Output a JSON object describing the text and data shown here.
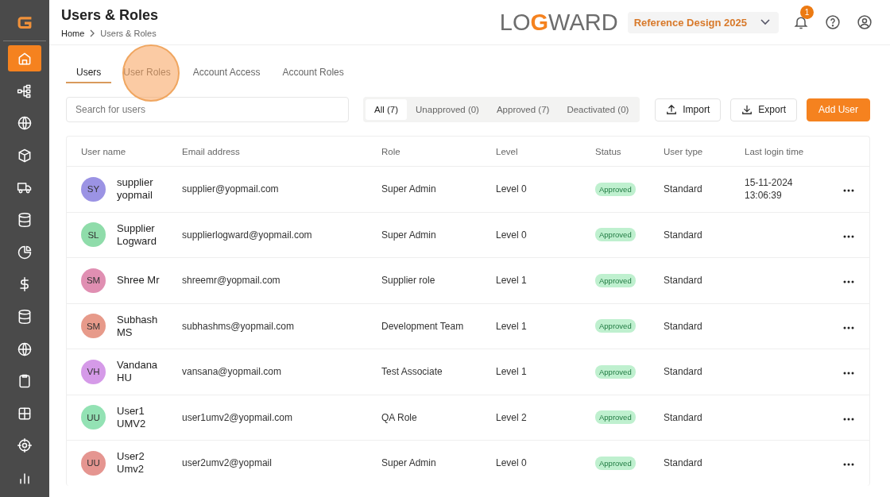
{
  "sidebar": {
    "items": [
      {
        "selected": true
      },
      {
        "selected": false
      },
      {
        "selected": false
      },
      {
        "selected": false
      },
      {
        "selected": false
      },
      {
        "selected": false
      },
      {
        "selected": false
      },
      {
        "selected": false
      },
      {
        "selected": false
      },
      {
        "selected": false
      },
      {
        "selected": false
      },
      {
        "selected": false
      },
      {
        "selected": false
      },
      {
        "selected": false
      }
    ]
  },
  "header": {
    "title": "Users & Roles",
    "breadcrumb": [
      "Home",
      "Users & Roles"
    ],
    "logo": {
      "before": "LO",
      "mark": "G",
      "after": "WARD"
    },
    "workspace": "Reference Design 2025",
    "notifications": "1"
  },
  "tabs": [
    {
      "label": "Users",
      "selected": true,
      "tapped": false
    },
    {
      "label": "User Roles",
      "selected": false,
      "tapped": true
    },
    {
      "label": "Account Access",
      "selected": false,
      "tapped": false
    },
    {
      "label": "Account Roles",
      "selected": false,
      "tapped": false
    }
  ],
  "search": {
    "placeholder": "Search for users"
  },
  "filters": [
    {
      "label": "All (7)",
      "selected": true
    },
    {
      "label": "Unapproved (0)",
      "selected": false
    },
    {
      "label": "Approved (7)",
      "selected": false
    },
    {
      "label": "Deactivated (0)",
      "selected": false
    }
  ],
  "buttons": [
    {
      "label": "Import",
      "kind": "import"
    },
    {
      "label": "Export",
      "kind": "export"
    },
    {
      "label": "Add User",
      "kind": "primary"
    }
  ],
  "table": {
    "columns": [
      "User name",
      "Email address",
      "Role",
      "Level",
      "Status",
      "User type",
      "Last login time"
    ],
    "rows": [
      {
        "initials": "SY",
        "color": "#9b93e4",
        "name": "supplier yopmail",
        "email": "supplier@yopmail.com",
        "role": "Super Admin",
        "level": "Level 0",
        "status": "Approved",
        "user_type": "Standard",
        "last_login": "15-11-2024 13:06:39"
      },
      {
        "initials": "SL",
        "color": "#8fdcaa",
        "name": "Supplier Logward",
        "email": "supplierlogward@yopmail.com",
        "role": "Super Admin",
        "level": "Level 0",
        "status": "Approved",
        "user_type": "Standard"
      },
      {
        "initials": "SM",
        "color": "#e08fb2",
        "name": "Shree Mr",
        "email": "shreemr@yopmail.com",
        "role": "Supplier role",
        "level": "Level 1",
        "status": "Approved",
        "user_type": "Standard"
      },
      {
        "initials": "SM",
        "color": "#e79a8a",
        "name": "Subhash MS",
        "email": "subhashms@yopmail.com",
        "role": "Development Team",
        "level": "Level 1",
        "status": "Approved",
        "user_type": "Standard"
      },
      {
        "initials": "VH",
        "color": "#d59ae8",
        "name": "Vandana HU",
        "email": "vansana@yopmail.com",
        "role": "Test Associate",
        "level": "Level 1",
        "status": "Approved",
        "user_type": "Standard"
      },
      {
        "initials": "UU",
        "color": "#93e2b4",
        "name": "User1 UMV2",
        "email": "user1umv2@yopmail.com",
        "role": "QA Role",
        "level": "Level 2",
        "status": "Approved",
        "user_type": "Standard"
      },
      {
        "initials": "UU",
        "color": "#e59590",
        "name": "User2 Umv2",
        "email": "user2umv2@yopmail",
        "role": "Super Admin",
        "level": "Level 0",
        "status": "Approved",
        "user_type": "Standard"
      }
    ]
  }
}
